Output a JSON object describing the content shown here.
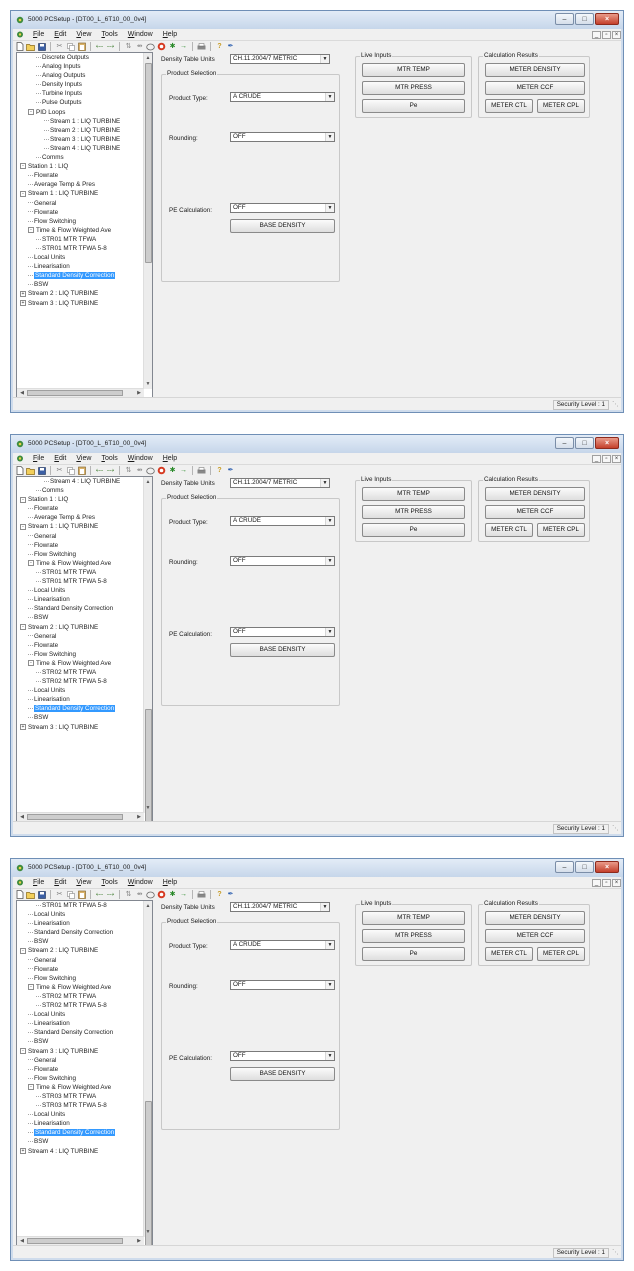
{
  "windows": [
    {
      "title": "5000 PCSetup - [DT00_L_6T10_00_0v4]",
      "tree_items": [
        {
          "label": "Discrete Outputs",
          "depth": 2,
          "expander": ""
        },
        {
          "label": "Analog Inputs",
          "depth": 2,
          "expander": ""
        },
        {
          "label": "Analog Outputs",
          "depth": 2,
          "expander": ""
        },
        {
          "label": "Density Inputs",
          "depth": 2,
          "expander": ""
        },
        {
          "label": "Turbine Inputs",
          "depth": 2,
          "expander": ""
        },
        {
          "label": "Pulse Outputs",
          "depth": 2,
          "expander": ""
        },
        {
          "label": "PID Loops",
          "depth": 1,
          "expander": "-"
        },
        {
          "label": "Stream 1 : LIQ TURBINE",
          "depth": 3,
          "expander": ""
        },
        {
          "label": "Stream 2 : LIQ TURBINE",
          "depth": 3,
          "expander": ""
        },
        {
          "label": "Stream 3 : LIQ TURBINE",
          "depth": 3,
          "expander": ""
        },
        {
          "label": "Stream 4 : LIQ TURBINE",
          "depth": 3,
          "expander": ""
        },
        {
          "label": "Comms",
          "depth": 2,
          "expander": ""
        },
        {
          "label": "Station 1 : LIQ",
          "depth": 0,
          "expander": "-"
        },
        {
          "label": "Flowrate",
          "depth": 1,
          "expander": ""
        },
        {
          "label": "Average Temp & Pres",
          "depth": 1,
          "expander": ""
        },
        {
          "label": "Stream 1 : LIQ TURBINE",
          "depth": 0,
          "expander": "-"
        },
        {
          "label": "General",
          "depth": 1,
          "expander": ""
        },
        {
          "label": "Flowrate",
          "depth": 1,
          "expander": ""
        },
        {
          "label": "Flow Switching",
          "depth": 1,
          "expander": ""
        },
        {
          "label": "Time & Flow Weighted Ave",
          "depth": 1,
          "expander": "-"
        },
        {
          "label": "STR01 MTR TFWA",
          "depth": 2,
          "expander": ""
        },
        {
          "label": "STR01 MTR TFWA 5-8",
          "depth": 2,
          "expander": ""
        },
        {
          "label": "Local Units",
          "depth": 1,
          "expander": ""
        },
        {
          "label": "Linearisation",
          "depth": 1,
          "expander": ""
        },
        {
          "label": "Standard Density Correction",
          "depth": 1,
          "expander": "",
          "selected": true
        },
        {
          "label": "BSW",
          "depth": 1,
          "expander": ""
        },
        {
          "label": "Stream 2 : LIQ TURBINE",
          "depth": 0,
          "expander": "+"
        },
        {
          "label": "Stream 3 : LIQ TURBINE",
          "depth": 0,
          "expander": "+"
        }
      ]
    },
    {
      "title": "5000 PCSetup - [DT00_L_6T10_00_0v4]",
      "tree_items": [
        {
          "label": "Stream 4 : LIQ TURBINE",
          "depth": 3,
          "expander": ""
        },
        {
          "label": "Comms",
          "depth": 2,
          "expander": ""
        },
        {
          "label": "Station 1 : LIQ",
          "depth": 0,
          "expander": "-"
        },
        {
          "label": "Flowrate",
          "depth": 1,
          "expander": ""
        },
        {
          "label": "Average Temp & Pres",
          "depth": 1,
          "expander": ""
        },
        {
          "label": "Stream 1 : LIQ TURBINE",
          "depth": 0,
          "expander": "-"
        },
        {
          "label": "General",
          "depth": 1,
          "expander": ""
        },
        {
          "label": "Flowrate",
          "depth": 1,
          "expander": ""
        },
        {
          "label": "Flow Switching",
          "depth": 1,
          "expander": ""
        },
        {
          "label": "Time & Flow Weighted Ave",
          "depth": 1,
          "expander": "-"
        },
        {
          "label": "STR01 MTR TFWA",
          "depth": 2,
          "expander": ""
        },
        {
          "label": "STR01 MTR TFWA 5-8",
          "depth": 2,
          "expander": ""
        },
        {
          "label": "Local Units",
          "depth": 1,
          "expander": ""
        },
        {
          "label": "Linearisation",
          "depth": 1,
          "expander": ""
        },
        {
          "label": "Standard Density Correction",
          "depth": 1,
          "expander": ""
        },
        {
          "label": "BSW",
          "depth": 1,
          "expander": ""
        },
        {
          "label": "Stream 2 : LIQ TURBINE",
          "depth": 0,
          "expander": "-"
        },
        {
          "label": "General",
          "depth": 1,
          "expander": ""
        },
        {
          "label": "Flowrate",
          "depth": 1,
          "expander": ""
        },
        {
          "label": "Flow Switching",
          "depth": 1,
          "expander": ""
        },
        {
          "label": "Time & Flow Weighted Ave",
          "depth": 1,
          "expander": "-"
        },
        {
          "label": "STR02 MTR TFWA",
          "depth": 2,
          "expander": ""
        },
        {
          "label": "STR02 MTR TFWA 5-8",
          "depth": 2,
          "expander": ""
        },
        {
          "label": "Local Units",
          "depth": 1,
          "expander": ""
        },
        {
          "label": "Linearisation",
          "depth": 1,
          "expander": ""
        },
        {
          "label": "Standard Density Correction",
          "depth": 1,
          "expander": "",
          "selected": true
        },
        {
          "label": "BSW",
          "depth": 1,
          "expander": ""
        },
        {
          "label": "Stream 3 : LIQ TURBINE",
          "depth": 0,
          "expander": "+"
        }
      ]
    },
    {
      "title": "5000 PCSetup - [DT00_L_6T10_00_0v4]",
      "tree_items": [
        {
          "label": "STR01 MTR TFWA 5-8",
          "depth": 2,
          "expander": ""
        },
        {
          "label": "Local Units",
          "depth": 1,
          "expander": ""
        },
        {
          "label": "Linearisation",
          "depth": 1,
          "expander": ""
        },
        {
          "label": "Standard Density Correction",
          "depth": 1,
          "expander": ""
        },
        {
          "label": "BSW",
          "depth": 1,
          "expander": ""
        },
        {
          "label": "Stream 2 : LIQ TURBINE",
          "depth": 0,
          "expander": "-"
        },
        {
          "label": "General",
          "depth": 1,
          "expander": ""
        },
        {
          "label": "Flowrate",
          "depth": 1,
          "expander": ""
        },
        {
          "label": "Flow Switching",
          "depth": 1,
          "expander": ""
        },
        {
          "label": "Time & Flow Weighted Ave",
          "depth": 1,
          "expander": "-"
        },
        {
          "label": "STR02 MTR TFWA",
          "depth": 2,
          "expander": ""
        },
        {
          "label": "STR02 MTR TFWA 5-8",
          "depth": 2,
          "expander": ""
        },
        {
          "label": "Local Units",
          "depth": 1,
          "expander": ""
        },
        {
          "label": "Linearisation",
          "depth": 1,
          "expander": ""
        },
        {
          "label": "Standard Density Correction",
          "depth": 1,
          "expander": ""
        },
        {
          "label": "BSW",
          "depth": 1,
          "expander": ""
        },
        {
          "label": "Stream 3 : LIQ TURBINE",
          "depth": 0,
          "expander": "-"
        },
        {
          "label": "General",
          "depth": 1,
          "expander": ""
        },
        {
          "label": "Flowrate",
          "depth": 1,
          "expander": ""
        },
        {
          "label": "Flow Switching",
          "depth": 1,
          "expander": ""
        },
        {
          "label": "Time & Flow Weighted Ave",
          "depth": 1,
          "expander": "-"
        },
        {
          "label": "STR03 MTR TFWA",
          "depth": 2,
          "expander": ""
        },
        {
          "label": "STR03 MTR TFWA 5-8",
          "depth": 2,
          "expander": ""
        },
        {
          "label": "Local Units",
          "depth": 1,
          "expander": ""
        },
        {
          "label": "Linearisation",
          "depth": 1,
          "expander": ""
        },
        {
          "label": "Standard Density Correction",
          "depth": 1,
          "expander": "",
          "selected": true
        },
        {
          "label": "BSW",
          "depth": 1,
          "expander": ""
        },
        {
          "label": "Stream 4 : LIQ TURBINE",
          "depth": 0,
          "expander": "+"
        }
      ]
    }
  ],
  "menu": {
    "items": [
      {
        "first": "F",
        "rest": "ile"
      },
      {
        "first": "E",
        "rest": "dit"
      },
      {
        "first": "V",
        "rest": "iew"
      },
      {
        "first": "T",
        "rest": "ools"
      },
      {
        "first": "W",
        "rest": "indow"
      },
      {
        "first": "H",
        "rest": "elp"
      }
    ]
  },
  "form": {
    "density_units_label": "Density Table Units",
    "density_units_value": "CH.11.2004/7 METRIC",
    "product_selection_title": "Product Selection",
    "product_type_label": "Product Type:",
    "product_type_value": "A CRUDE",
    "rounding_label": "Rounding:",
    "rounding_value": "OFF",
    "pe_calc_label": "PE Calculation:",
    "pe_calc_value": "OFF",
    "base_density_button": "BASE DENSITY",
    "live_inputs_title": "Live Inputs",
    "mtr_temp_button": "MTR TEMP",
    "mtr_press_button": "MTR PRESS",
    "pe_button": "Pe",
    "calc_results_title": "Calculation Results",
    "meter_density_button": "METER DENSITY",
    "meter_ccf_button": "METER CCF",
    "meter_ctl_button": "METER CTL",
    "meter_cpl_button": "METER CPL"
  },
  "status": {
    "security_level": "Security Level : 1"
  },
  "colors": {
    "selection": "#3399ff",
    "title_gradient_top": "#e3ecf7",
    "close_button": "#c4402c"
  },
  "icons": {
    "app": "gear-leaf-icon",
    "toolbar": [
      "new-file-icon",
      "open-folder-icon",
      "save-icon",
      "cut-icon",
      "copy-icon",
      "paste-icon",
      "back-icon",
      "forward-icon",
      "connect-icon",
      "stop-icon",
      "green-arrow-icon",
      "send-icon",
      "print-icon",
      "help-icon",
      "pen-icon"
    ]
  }
}
